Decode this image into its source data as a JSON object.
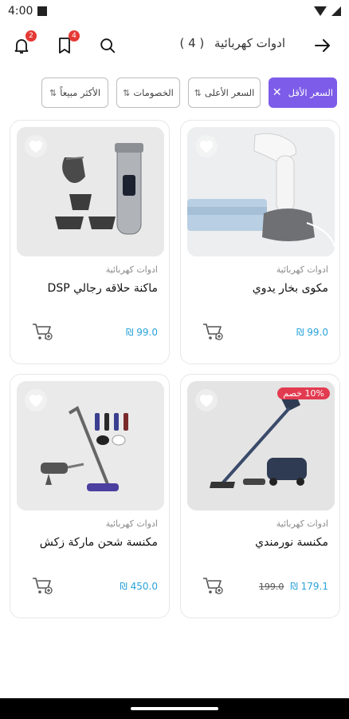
{
  "status": {
    "time": "4:00"
  },
  "header": {
    "title": "ادوات كهربائية",
    "count": "( 4 )",
    "notifications_badge": "2",
    "wishlist_badge": "4",
    "icons": [
      "back-arrow-icon",
      "search-icon",
      "bookmark-icon",
      "bell-icon"
    ]
  },
  "filters": [
    {
      "label": "السعر الأقل",
      "active": true
    },
    {
      "label": "السعر الأعلى",
      "active": false
    },
    {
      "label": "الخصومات",
      "active": false
    },
    {
      "label": "الأكثر مبيعاً",
      "active": false
    }
  ],
  "products": [
    {
      "category": "ادوات كهربائية",
      "name": "مكوى بخار يدوي",
      "price": "99.0 ₪",
      "old_price": "",
      "discount": "",
      "image": "garment-steamer"
    },
    {
      "category": "ادوات كهربائية",
      "name": "ماكنة حلاقه رجالي DSP",
      "price": "99.0 ₪",
      "old_price": "",
      "discount": "",
      "image": "hair-clipper"
    },
    {
      "category": "ادوات كهربائية",
      "name": "مكنسة نورمندي",
      "price": "179.1 ₪",
      "old_price": "199.0",
      "discount": "10% خصم",
      "image": "stick-vacuum"
    },
    {
      "category": "ادوات كهربائية",
      "name": "مكنسة شحن ماركة زكش",
      "price": "450.0 ₪",
      "old_price": "",
      "discount": "",
      "image": "cordless-vacuum"
    }
  ],
  "colors": {
    "accent": "#7c5ce8",
    "price": "#2aa3d9",
    "badge": "#e53935",
    "discount": "#e23b50"
  }
}
